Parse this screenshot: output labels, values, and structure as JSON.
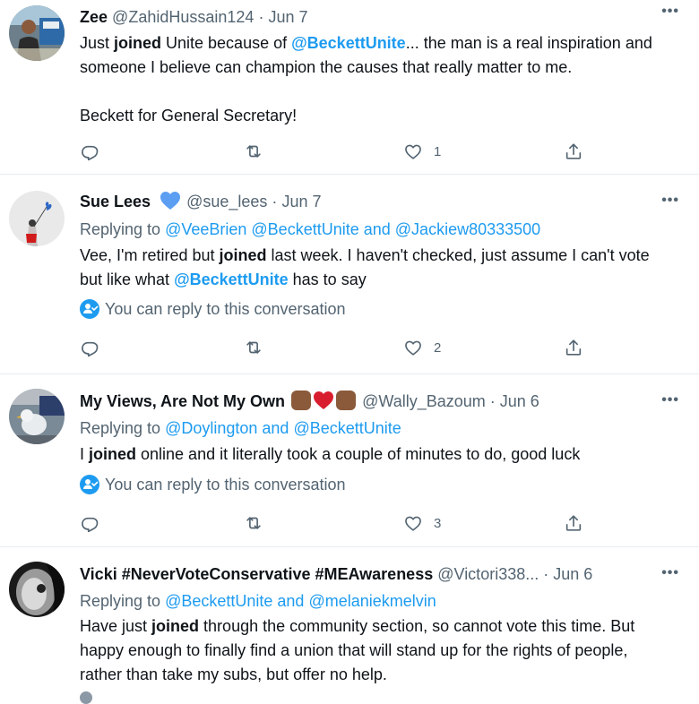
{
  "tweets": [
    {
      "name": "Zee",
      "handle": "@ZahidHussain124",
      "sep": "·",
      "date": "Jun 7",
      "more": "•••",
      "body_parts": [
        "Just ",
        "joined",
        " Unite because of ",
        "@BeckettUnite",
        "... the man is a real inspiration and someone I believe can champion the causes that really matter to me."
      ],
      "body_line2": "Beckett for General Secretary!",
      "likes": "1"
    },
    {
      "name": "Sue Lees",
      "handle": "@sue_lees",
      "sep": "·",
      "date": "Jun 7",
      "more": "•••",
      "replying_prefix": "Replying to ",
      "reply_a": "@VeeBrien",
      "reply_b": "@BeckettUnite",
      "and": " and ",
      "reply_c": "@Jackiew80333500",
      "body_parts": [
        "Vee, I'm retired but ",
        "joined",
        " last week. I haven't checked, just assume I can't vote but like what ",
        "@BeckettUnite",
        " has to say"
      ],
      "convo": "You can reply to this conversation",
      "likes": "2"
    },
    {
      "name": "My Views, Are Not My Own",
      "handle": "@Wally_Bazoum",
      "sep": "·",
      "date": "Jun 6",
      "more": "•••",
      "replying_prefix": "Replying to ",
      "reply_a": "@Doylington",
      "and": " and ",
      "reply_b": "@BeckettUnite",
      "body_parts": [
        "I ",
        "joined",
        " online and it literally took a couple of minutes to do, good luck"
      ],
      "convo": "You can reply to this conversation",
      "likes": "3"
    },
    {
      "name": "Vicki #NeverVoteConservative #MEAwareness",
      "handle": "@Victori338...",
      "sep": "·",
      "date": "Jun 6",
      "more": "•••",
      "replying_prefix": "Replying to ",
      "reply_a": "@BeckettUnite",
      "and": " and ",
      "reply_b": "@melaniekmelvin",
      "body_parts": [
        "Have just ",
        "joined",
        " through the community section, so cannot vote this time. But happy enough to finally find a union that will stand up for the rights of people, rather than take my subs, but offer no help."
      ]
    }
  ],
  "icons": {
    "reply": "reply-icon",
    "retweet": "retweet-icon",
    "like": "heart-icon",
    "share": "share-icon",
    "convo": "person-check-icon"
  },
  "colors": {
    "accent": "#1d9bf0",
    "muted": "#536471",
    "divider": "#e6ecf0",
    "verified_heart": "#5b9ef2"
  }
}
